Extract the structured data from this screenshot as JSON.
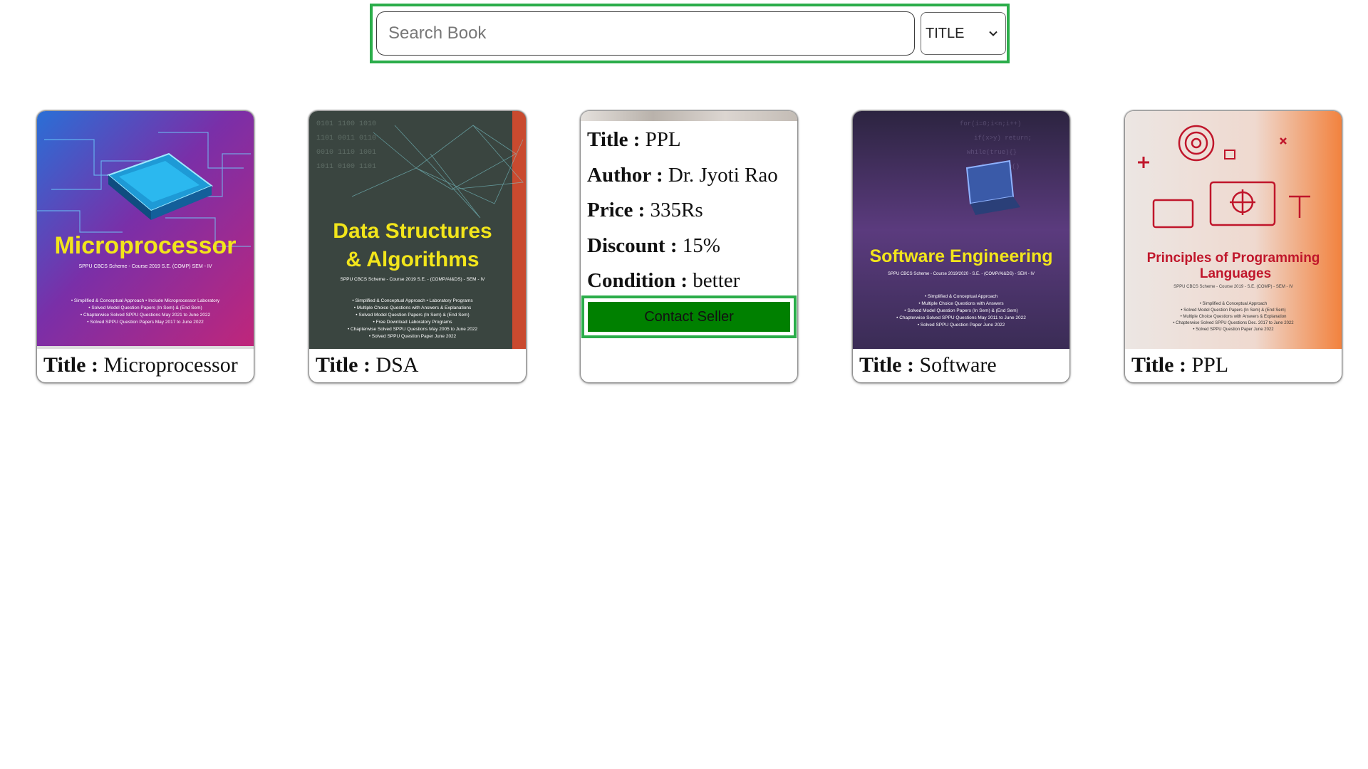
{
  "search": {
    "placeholder": "Search Book",
    "filter_selected": "TITLE"
  },
  "title_label": "Title :",
  "books": [
    {
      "title": "Microprocessor",
      "cover": {
        "title_line1": "Microprocessor",
        "title_line2": "",
        "subtitle": "SPPU CBCS Scheme - Course 2019 S.E. (COMP) SEM - IV",
        "colors": [
          "#2a5fbf",
          "#8b2a9e",
          "#b02a7e"
        ],
        "title_color": "#f2e51b"
      }
    },
    {
      "title": "DSA",
      "cover": {
        "title_line1": "Data Structures",
        "title_line2": "& Algorithms",
        "subtitle": "SPPU CBCS Scheme - Course 2019 S.E. (COMP/AI&DS) SEM - IV",
        "colors": [
          "#2f3a3a",
          "#3e4a40",
          "#4a5546"
        ],
        "title_color": "#f2e51b"
      }
    },
    {
      "title": "PPL",
      "author": "Dr. Jyoti Rao",
      "price": "335Rs",
      "discount": "15%",
      "condition": "better",
      "labels": {
        "title": "Title :",
        "author": "Author :",
        "price": "Price :",
        "discount": "Discount :",
        "condition": "Condition :"
      },
      "contact_label": "Contact Seller",
      "button_color": "#008000"
    },
    {
      "title": "Software",
      "cover": {
        "title_line1": "Software Engineering",
        "title_line2": "",
        "subtitle": "SPPU CBCS Scheme - Course 2019/2020 - S.E. - (COMP/AI&DS) - SEM - IV",
        "colors": [
          "#3a2d5e",
          "#5a3c7a",
          "#3d2f58"
        ],
        "title_color": "#f2e51b"
      }
    },
    {
      "title": "PPL",
      "cover": {
        "title_line1": "Principles of Programming",
        "title_line2": "Languages",
        "subtitle": "SPPU CBCS Scheme - Course 2019 - S.E. (COMP) - SEM - IV",
        "colors": [
          "#e9e3e0",
          "#eecfc2",
          "#f08a4a"
        ],
        "title_color": "#c0162b"
      }
    }
  ],
  "accent_color": "#2bad4a"
}
